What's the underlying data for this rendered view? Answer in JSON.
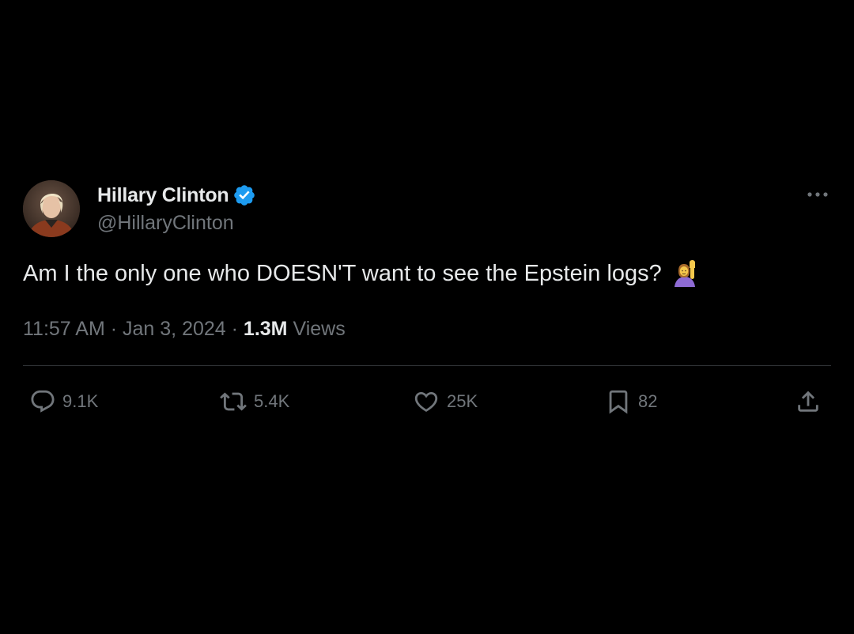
{
  "tweet": {
    "author": {
      "display_name": "Hillary Clinton",
      "handle": "@HillaryClinton",
      "verified": true
    },
    "text": "Am I the only one who DOESN'T want to see the Epstein logs?",
    "emoji": "woman-raising-hand",
    "time": "11:57 AM",
    "separator": "·",
    "date": "Jan 3, 2024",
    "views_count": "1.3M",
    "views_label": "Views",
    "stats": {
      "replies": "9.1K",
      "reposts": "5.4K",
      "likes": "25K",
      "bookmarks": "82"
    }
  },
  "colors": {
    "background": "#000000",
    "primary_text": "#e7e9ea",
    "secondary_text": "#71767b",
    "divider": "#2f3336",
    "verified_badge": "#1d9bf0"
  },
  "icons": {
    "more": "more-horizontal-icon",
    "reply": "reply-icon",
    "repost": "repost-icon",
    "like": "heart-icon",
    "bookmark": "bookmark-icon",
    "share": "share-icon",
    "verified": "verified-badge-icon"
  }
}
